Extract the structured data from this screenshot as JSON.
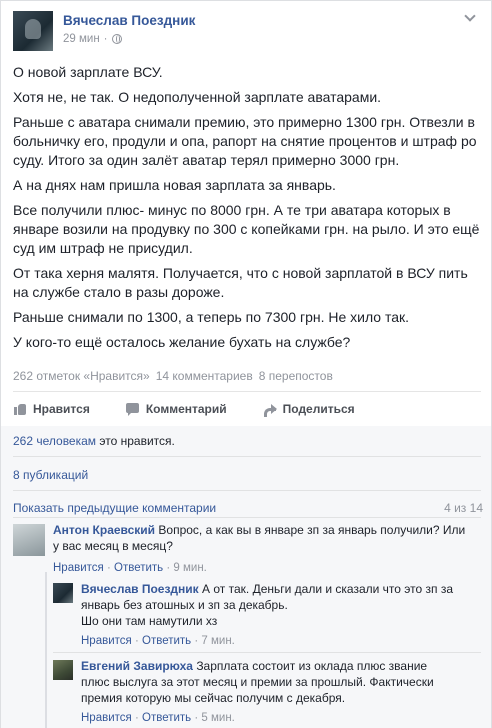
{
  "post": {
    "author": "Вячеслав Поездник",
    "time": "29 мин",
    "separator": "·",
    "paragraphs": [
      "О новой зарплате ВСУ.",
      "Хотя не, не так. О недополученной зарплате аватарами.",
      "Раньше с аватара снимали премию, это примерно 1300 грн. Отвезли в больничку его, продули и опа, рапорт на снятие процентов и штраф ро суду. Итого за один залёт аватар терял примерно 3000 грн.",
      "А на днях нам пришла новая зарплата за январь.",
      "Все получили плюс- минус по 8000 грн. А те три аватара которых в январе возили на продувку по 300 с копейками грн. на рыло. И это ещё суд им штраф не присудил.",
      "От така херня малятя. Получается, что с новой зарплатой в ВСУ пить на службе стало в разы дороже.",
      "Раньше снимали по 1300, а теперь по 7300 грн. Не хило так.",
      "У кого-то ещё осталось желание бухать на службе?"
    ]
  },
  "stats": {
    "likes": "262 отметок «Нравится»",
    "comments": "14 комментариев",
    "shares": "8 перепостов"
  },
  "actions": {
    "like": "Нравится",
    "comment": "Комментарий",
    "share": "Поделиться"
  },
  "feedback": {
    "likes_count": "262 человекам",
    "likes_suffix": "это нравится.",
    "shares": "8 публикаций",
    "prev_comments": "Показать предыдущие комментарии",
    "count": "4 из 14"
  },
  "comments": [
    {
      "author": "Антон Краевский",
      "text_lines": [
        "Вопрос, а как вы в январе зп за январь получили? Или",
        "у вас месяц в месяц?"
      ],
      "like": "Нравится",
      "reply": "Ответить",
      "time": "9 мин."
    },
    {
      "author": "Вячеслав Поездник",
      "text_lines": [
        "А от так. Деньги дали и сказали что это зп за",
        "январь без атошных и зп за декабрь.",
        "Шо они там намутили хз"
      ],
      "like": "Нравится",
      "reply": "Ответить",
      "time": "7 мин."
    },
    {
      "author": "Евгений Завирюха",
      "text_lines": [
        "Зарплата состоит из оклада плюс звание",
        "плюс выслуга за этот месяц и премии за прошлый. Фактически",
        "премия которую мы сейчас получим с декабря."
      ],
      "like": "Нравится",
      "reply": "Ответить",
      "time": "5 мин."
    }
  ],
  "link_separator": "·"
}
